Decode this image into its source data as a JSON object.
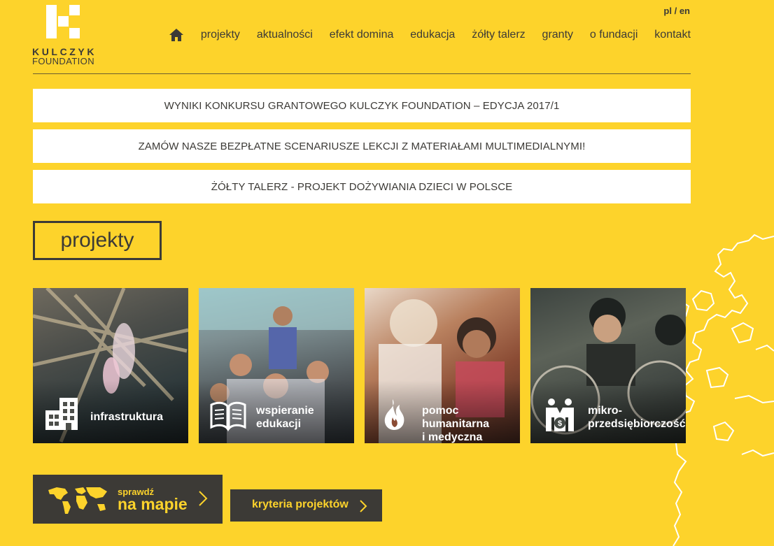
{
  "logo": {
    "name": "KULCZYK",
    "sub": "FOUNDATION"
  },
  "lang": {
    "pl": "pl",
    "sep": " / ",
    "en": "en"
  },
  "nav": {
    "items": [
      "projekty",
      "aktualności",
      "efekt domina",
      "edukacja",
      "żółty talerz",
      "granty",
      "o fundacji",
      "kontakt"
    ]
  },
  "banners": [
    "WYNIKI KONKURSU GRANTOWEGO KULCZYK FOUNDATION – EDYCJA 2017/1",
    "ZAMÓW NASZE BEZPŁATNE SCENARIUSZE LEKCJI Z MATERIAŁAMI MULTIMEDIALNYMI!",
    "ŻÓŁTY TALERZ - PROJEKT DOŻYWIANIA DZIECI W POLSCE"
  ],
  "section_title": "projekty",
  "cards": [
    {
      "label_1": "infrastruktura",
      "label_2": "",
      "icon": "buildings-icon"
    },
    {
      "label_1": "wspieranie",
      "label_2": "edukacji",
      "icon": "open-book-icon"
    },
    {
      "label_1": "pomoc humanitarna",
      "label_2": "i medyczna",
      "icon": "flame-icon"
    },
    {
      "label_1": "mikro-",
      "label_2": "przedsiębiorczość",
      "icon": "people-coin-icon"
    }
  ],
  "map_button": {
    "small": "sprawdź",
    "big": "na mapie",
    "icon": "world-map-icon"
  },
  "criteria_button": {
    "label": "kryteria projektów"
  },
  "colors": {
    "background": "#fdd32b",
    "dark": "#3c3a36",
    "white": "#ffffff"
  }
}
